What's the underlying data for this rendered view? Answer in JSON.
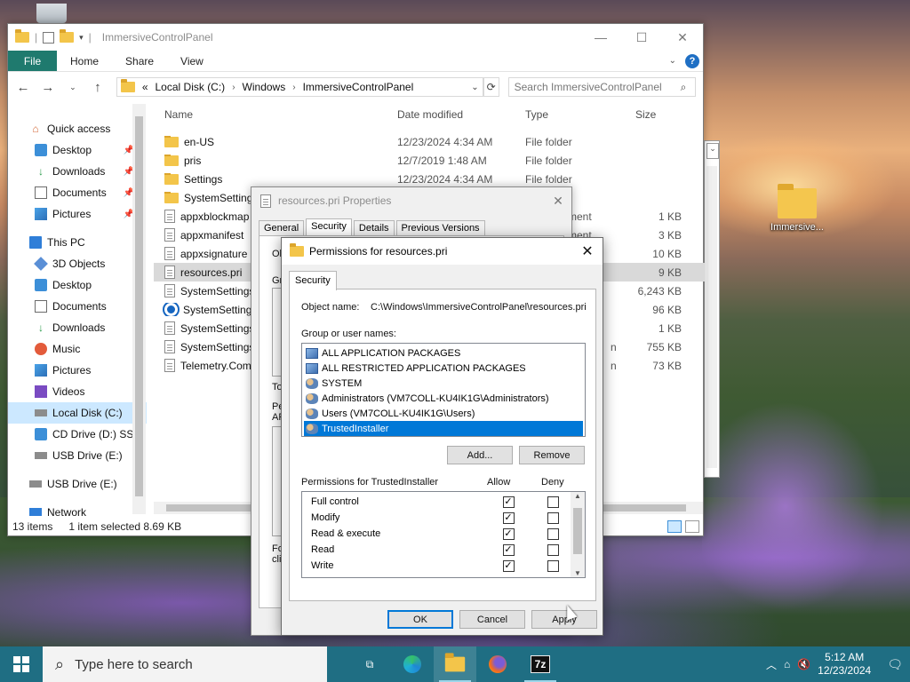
{
  "desktop": {
    "icons": [
      {
        "label": "Immersive..."
      }
    ]
  },
  "explorer": {
    "title": "ImmersiveControlPanel",
    "ribbon_tabs": [
      "File",
      "Home",
      "Share",
      "View"
    ],
    "address": [
      "Local Disk (C:)",
      "Windows",
      "ImmersiveControlPanel"
    ],
    "address_prefix": "«",
    "search_placeholder": "Search ImmersiveControlPanel",
    "columns": {
      "name": "Name",
      "date": "Date modified",
      "type": "Type",
      "size": "Size"
    },
    "nav": [
      {
        "label": "Quick access",
        "icon": "star-icon"
      },
      {
        "label": "Desktop",
        "icon": "desktop-icon",
        "pinned": true
      },
      {
        "label": "Downloads",
        "icon": "download-icon",
        "pinned": true
      },
      {
        "label": "Documents",
        "icon": "documents-icon",
        "pinned": true
      },
      {
        "label": "Pictures",
        "icon": "pictures-icon",
        "pinned": true
      },
      {
        "label": "This PC",
        "icon": "computer-icon"
      },
      {
        "label": "3D Objects",
        "icon": "cube-icon"
      },
      {
        "label": "Desktop",
        "icon": "desktop-icon"
      },
      {
        "label": "Documents",
        "icon": "documents-icon"
      },
      {
        "label": "Downloads",
        "icon": "download-icon"
      },
      {
        "label": "Music",
        "icon": "music-icon"
      },
      {
        "label": "Pictures",
        "icon": "pictures-icon"
      },
      {
        "label": "Videos",
        "icon": "video-icon"
      },
      {
        "label": "Local Disk (C:)",
        "icon": "drive-icon"
      },
      {
        "label": "CD Drive (D:) SSS",
        "icon": "cd-drive-icon"
      },
      {
        "label": "USB Drive (E:)",
        "icon": "usb-drive-icon"
      },
      {
        "label": "USB Drive (E:)",
        "icon": "usb-drive-icon"
      },
      {
        "label": "Network",
        "icon": "network-icon"
      }
    ],
    "files": [
      {
        "name": "en-US",
        "date": "12/23/2024 4:34 AM",
        "type": "File folder",
        "size": ""
      },
      {
        "name": "pris",
        "date": "12/7/2019 1:48 AM",
        "type": "File folder",
        "size": ""
      },
      {
        "name": "Settings",
        "date": "12/23/2024 4:34 AM",
        "type": "File folder",
        "size": ""
      },
      {
        "name": "SystemSettings",
        "date": "",
        "type": "",
        "size": ""
      },
      {
        "name": "appxblockmap",
        "date": "",
        "type": "ment",
        "size": "1 KB"
      },
      {
        "name": "appxmanifest",
        "date": "",
        "type": "ment",
        "size": "3 KB"
      },
      {
        "name": "appxsignature",
        "date": "",
        "type": "",
        "size": "10 KB"
      },
      {
        "name": "resources.pri",
        "date": "",
        "type": "",
        "size": "9 KB"
      },
      {
        "name": "SystemSettings",
        "date": "",
        "type": "",
        "size": "6,243 KB"
      },
      {
        "name": "SystemSettings",
        "date": "",
        "type": "",
        "size": "96 KB"
      },
      {
        "name": "SystemSettings",
        "date": "",
        "type": "",
        "size": "1 KB"
      },
      {
        "name": "SystemSettings",
        "date": "",
        "type": "n",
        "size": "755 KB"
      },
      {
        "name": "Telemetry.Com",
        "date": "",
        "type": "n",
        "size": "73 KB"
      }
    ],
    "status": {
      "count": "13 items",
      "selected": "1 item selected  8.69 KB"
    }
  },
  "properties": {
    "title": "resources.pri Properties",
    "tabs": [
      "General",
      "Security",
      "Details",
      "Previous Versions"
    ],
    "fragments": [
      "Obj",
      "Grou",
      "To",
      "Pe",
      "AP",
      "Fo",
      "clic"
    ]
  },
  "permissions": {
    "title": "Permissions for resources.pri",
    "tab": "Security",
    "object_label": "Object name:",
    "object_value": "C:\\Windows\\ImmersiveControlPanel\\resources.pri",
    "group_label": "Group or user names:",
    "groups": [
      {
        "name": "ALL APPLICATION PACKAGES",
        "icon": "group-icon"
      },
      {
        "name": "ALL RESTRICTED APPLICATION PACKAGES",
        "icon": "group-icon"
      },
      {
        "name": "SYSTEM",
        "icon": "user-group-icon"
      },
      {
        "name": "Administrators (VM7COLL-KU4IK1G\\Administrators)",
        "icon": "user-group-icon"
      },
      {
        "name": "Users (VM7COLL-KU4IK1G\\Users)",
        "icon": "user-group-icon"
      },
      {
        "name": "TrustedInstaller",
        "icon": "user-group-icon"
      }
    ],
    "add_label": "Add...",
    "remove_label": "Remove",
    "perm_label": "Permissions for TrustedInstaller",
    "allow_label": "Allow",
    "deny_label": "Deny",
    "perms": [
      {
        "name": "Full control",
        "allow": true,
        "deny": false
      },
      {
        "name": "Modify",
        "allow": true,
        "deny": false
      },
      {
        "name": "Read & execute",
        "allow": true,
        "deny": false
      },
      {
        "name": "Read",
        "allow": true,
        "deny": false
      },
      {
        "name": "Write",
        "allow": true,
        "deny": false
      }
    ],
    "ok_label": "OK",
    "cancel_label": "Cancel",
    "apply_label": "Apply"
  },
  "taskbar": {
    "search_placeholder": "Type here to search",
    "time": "5:12 AM",
    "date": "12/23/2024"
  }
}
